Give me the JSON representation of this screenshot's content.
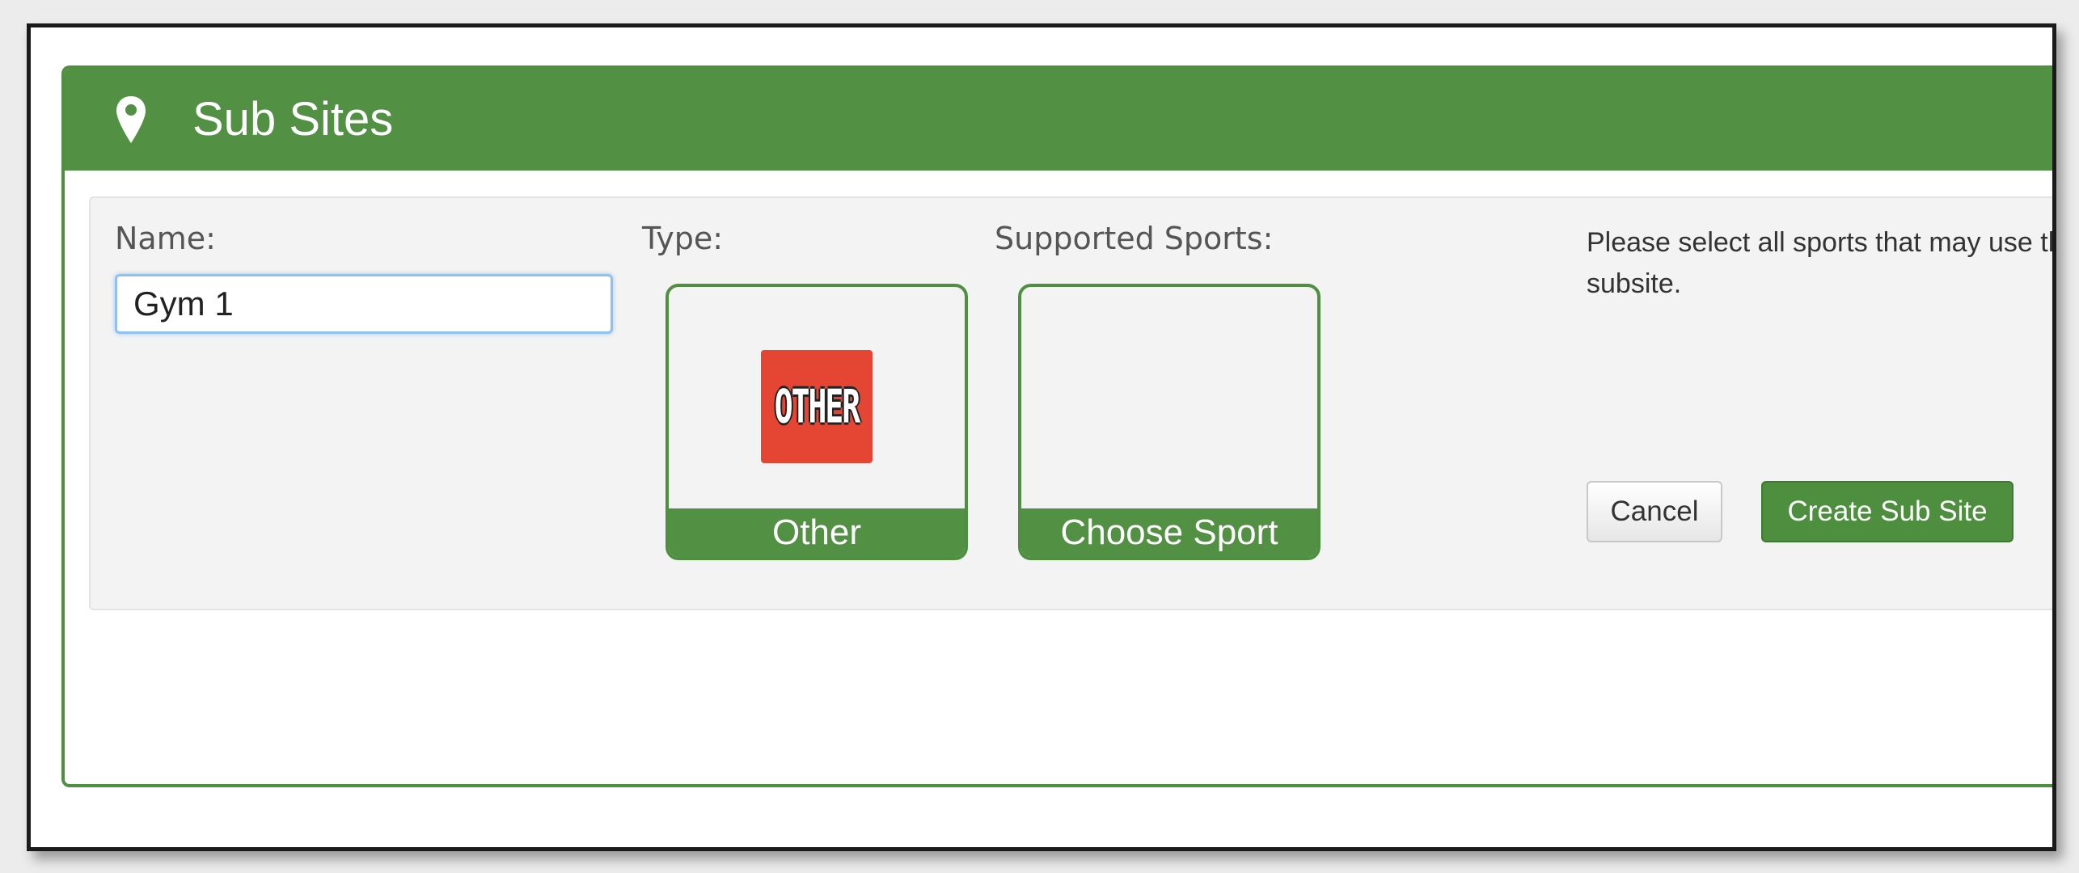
{
  "panel": {
    "title": "Sub Sites",
    "icon": "map-pin-icon"
  },
  "form": {
    "name_label": "Name:",
    "name_value": "Gym 1",
    "type_label": "Type:",
    "type_tile": {
      "logo_text": "OTHER",
      "caption": "Other"
    },
    "sports_label": "Supported Sports:",
    "sports_tile": {
      "caption": "Choose Sport"
    },
    "help_text": "Please select all sports that may use this subsite.",
    "cancel_label": "Cancel",
    "create_label": "Create Sub Site"
  },
  "colors": {
    "header_green": "#529143",
    "logo_red": "#e54634",
    "input_focus": "#8fc0ef"
  }
}
